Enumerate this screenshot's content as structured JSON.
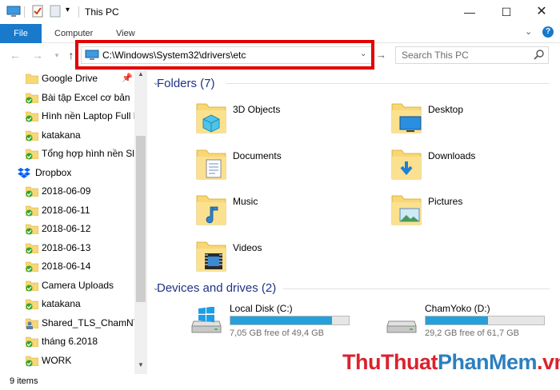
{
  "window": {
    "title": "This PC"
  },
  "ribbon": {
    "tabs": [
      "File",
      "Computer",
      "View"
    ]
  },
  "address": {
    "path": "C:\\Windows\\System32\\drivers\\etc",
    "search_placeholder": "Search This PC"
  },
  "sidebar": {
    "items": [
      {
        "label": "Google Drive",
        "icon": "folder-icon",
        "pinned": true
      },
      {
        "label": "Bài tập Excel cơ bản",
        "icon": "folder-sync-icon"
      },
      {
        "label": "Hình nền Laptop Full H",
        "icon": "folder-sync-icon"
      },
      {
        "label": "katakana",
        "icon": "folder-sync-icon"
      },
      {
        "label": "Tổng hợp hình nền Slic",
        "icon": "folder-sync-icon"
      },
      {
        "label": "Dropbox",
        "icon": "dropbox-icon"
      },
      {
        "label": "2018-06-09",
        "icon": "folder-sync-icon"
      },
      {
        "label": "2018-06-11",
        "icon": "folder-sync-icon"
      },
      {
        "label": "2018-06-12",
        "icon": "folder-sync-icon"
      },
      {
        "label": "2018-06-13",
        "icon": "folder-sync-icon"
      },
      {
        "label": "2018-06-14",
        "icon": "folder-sync-icon"
      },
      {
        "label": "Camera Uploads",
        "icon": "folder-sync-icon"
      },
      {
        "label": "katakana",
        "icon": "folder-sync-icon"
      },
      {
        "label": "Shared_TLS_ChamNT",
        "icon": "shared-folder-icon"
      },
      {
        "label": "tháng 6.2018",
        "icon": "folder-sync-icon"
      },
      {
        "label": "WORK",
        "icon": "folder-sync-icon"
      }
    ]
  },
  "folders": {
    "header": "Folders (7)",
    "items": [
      {
        "label": "3D Objects",
        "icon": "3d-objects-icon"
      },
      {
        "label": "Desktop",
        "icon": "desktop-icon"
      },
      {
        "label": "Documents",
        "icon": "documents-icon"
      },
      {
        "label": "Downloads",
        "icon": "downloads-icon"
      },
      {
        "label": "Music",
        "icon": "music-icon"
      },
      {
        "label": "Pictures",
        "icon": "pictures-icon"
      },
      {
        "label": "Videos",
        "icon": "videos-icon"
      }
    ]
  },
  "drives": {
    "header": "Devices and drives (2)",
    "items": [
      {
        "label": "Local Disk (C:)",
        "free": "7,05 GB free of 49,4 GB",
        "used_fraction": 0.857
      },
      {
        "label": "ChamYoko (D:)",
        "free": "29,2 GB free of 61,7 GB",
        "used_fraction": 0.527
      }
    ]
  },
  "status": {
    "items": "9 items"
  },
  "watermark": {
    "part1": "ThuThuat",
    "part2": "PhanMem",
    "part3": ".vn"
  },
  "colors": {
    "accent": "#1979ca",
    "highlight": "#e30000",
    "drive_fill": "#26a0da",
    "folder": "#f8d775"
  }
}
